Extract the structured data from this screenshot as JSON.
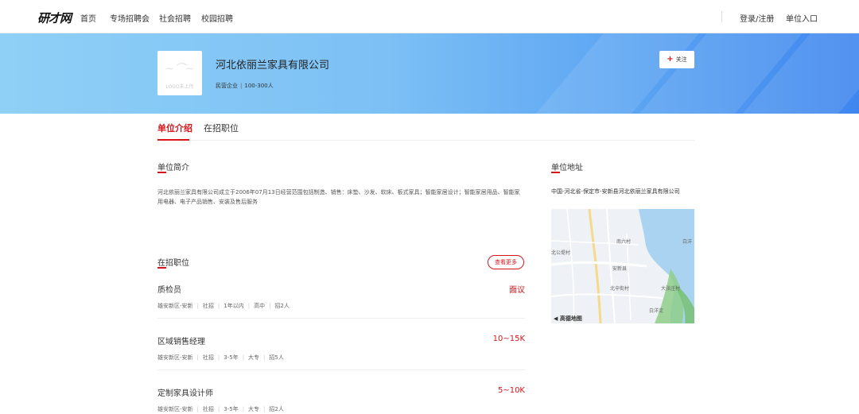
{
  "nav": {
    "logo": "研才网",
    "links": [
      "首页",
      "专场招聘会",
      "社会招聘",
      "校园招聘"
    ],
    "login": "登录/注册",
    "company_entry": "单位入口"
  },
  "company": {
    "name": "河北依丽兰家具有限公司",
    "logo_note": "LOGO未上传",
    "type": "民营企业",
    "size": "100-300人",
    "follow_label": "关注"
  },
  "tabs": [
    "单位介绍",
    "在招职位"
  ],
  "intro": {
    "title": "单位简介",
    "text": "河北依丽兰家具有限公司成立于2006年07月13日经营范围包括制造、销售：床垫、沙发、软床、板式家具；智能家居设计；智能家居用品、智能家用电器、电子产品销售、安装及售后服务"
  },
  "address": {
    "title": "单位地址",
    "text": "中国-河北省-保定市-安新县河北依丽兰家具有限公司"
  },
  "map": {
    "labels": [
      "南六村",
      "白洋",
      "北公堤村",
      "安新县",
      "北辛街村",
      "大张庄村",
      "白洋淀"
    ],
    "brand": "高德地图"
  },
  "jobs_section": {
    "title": "在招职位",
    "more_label": "查看更多",
    "jobs": [
      {
        "title": "质检员",
        "salary": "面议",
        "meta": [
          "雄安新区-安新",
          "社招",
          "1年以内",
          "高中",
          "招2人"
        ]
      },
      {
        "title": "区域销售经理",
        "salary": "10~15K",
        "meta": [
          "雄安新区-安新",
          "社招",
          "3-5年",
          "大专",
          "招5人"
        ]
      },
      {
        "title": "定制家具设计师",
        "salary": "5~10K",
        "meta": [
          "雄安新区-安新",
          "社招",
          "3-5年",
          "大专",
          "招2人"
        ]
      }
    ]
  },
  "colors": {
    "accent": "#d4161b",
    "banner_start": "#8fd0f6",
    "banner_end": "#3f86ef"
  }
}
